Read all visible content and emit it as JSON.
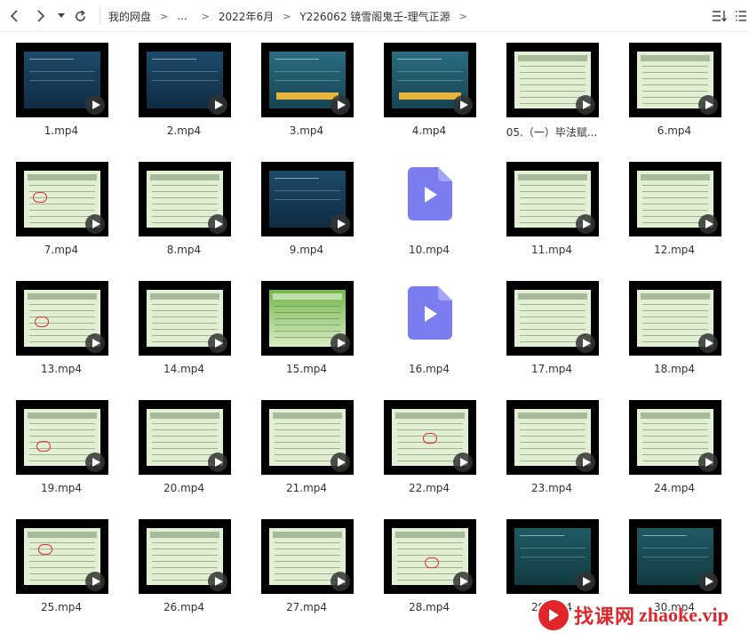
{
  "toolbar": {
    "breadcrumb": [
      "我的网盘",
      "...",
      "2022年6月",
      "Y226062 镜雪阁鬼壬-理气正源"
    ],
    "separator": ">"
  },
  "files": [
    {
      "name": "1.mp4",
      "style": "blue"
    },
    {
      "name": "2.mp4",
      "style": "blue"
    },
    {
      "name": "3.mp4",
      "style": "teal"
    },
    {
      "name": "4.mp4",
      "style": "teal"
    },
    {
      "name": "05.（一）毕法赋...",
      "style": "green"
    },
    {
      "name": "6.mp4",
      "style": "green"
    },
    {
      "name": "7.mp4",
      "style": "green"
    },
    {
      "name": "8.mp4",
      "style": "green"
    },
    {
      "name": "9.mp4",
      "style": "blue"
    },
    {
      "name": "10.mp4",
      "style": "icon"
    },
    {
      "name": "11.mp4",
      "style": "green"
    },
    {
      "name": "12.mp4",
      "style": "green"
    },
    {
      "name": "13.mp4",
      "style": "green"
    },
    {
      "name": "14.mp4",
      "style": "green"
    },
    {
      "name": "15.mp4",
      "style": "lime"
    },
    {
      "name": "16.mp4",
      "style": "icon"
    },
    {
      "name": "17.mp4",
      "style": "green"
    },
    {
      "name": "18.mp4",
      "style": "green"
    },
    {
      "name": "19.mp4",
      "style": "green"
    },
    {
      "name": "20.mp4",
      "style": "green"
    },
    {
      "name": "21.mp4",
      "style": "green"
    },
    {
      "name": "22.mp4",
      "style": "green"
    },
    {
      "name": "23.mp4",
      "style": "green"
    },
    {
      "name": "24.mp4",
      "style": "green"
    },
    {
      "name": "25.mp4",
      "style": "green"
    },
    {
      "name": "26.mp4",
      "style": "green"
    },
    {
      "name": "27.mp4",
      "style": "green"
    },
    {
      "name": "28.mp4",
      "style": "green"
    },
    {
      "name": "29.mp4",
      "style": "darkteal"
    },
    {
      "name": "30.mp4",
      "style": "darkteal"
    }
  ],
  "watermark": {
    "text": "找课网",
    "domain": "zhaoke.vip"
  },
  "colors": {
    "accent": "#7b7cf0",
    "watermark": "#e0262a"
  }
}
